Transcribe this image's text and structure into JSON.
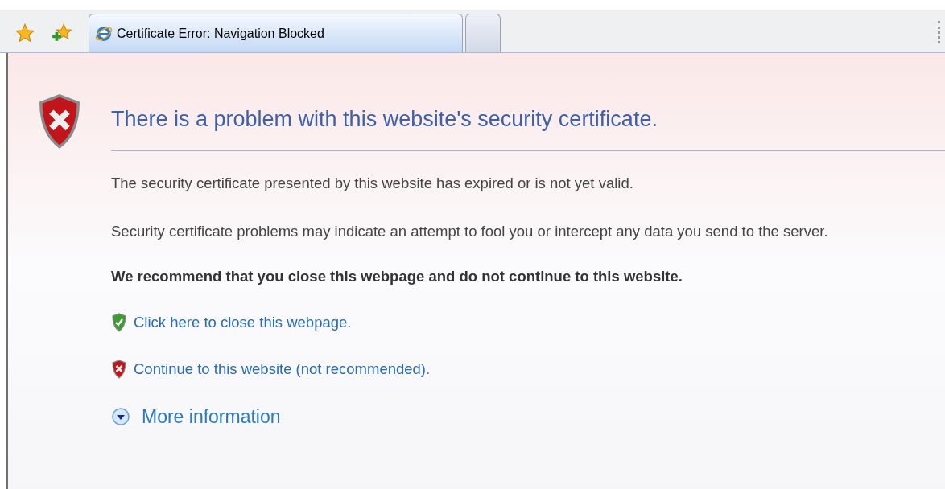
{
  "tabs": [
    {
      "title": "Certificate Error: Navigation Blocked",
      "selected": true
    },
    {
      "selected": false
    }
  ],
  "heading": "There is a problem with this website's security certificate.",
  "paragraphs": [
    "The security certificate presented by this website has expired or is not yet valid.",
    "Security certificate problems may indicate an attempt to fool you or intercept any data you send to the server."
  ],
  "recommendation": "We recommend that you close this webpage and do not continue to this website.",
  "links": [
    {
      "kind": "safe",
      "label": "Click here to close this webpage."
    },
    {
      "kind": "unsafe",
      "label": "Continue to this website (not recommended)."
    }
  ],
  "more_info": {
    "label": "More information",
    "expanded": false
  }
}
